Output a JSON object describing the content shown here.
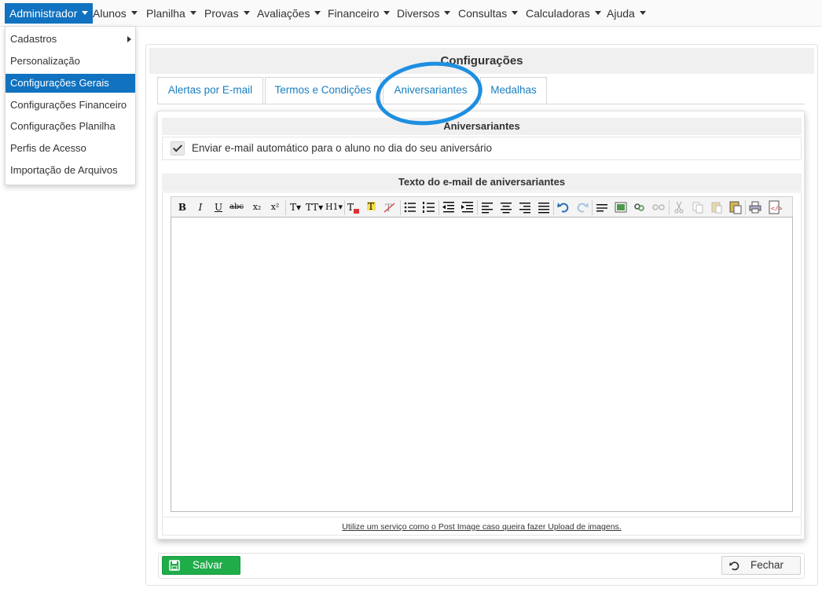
{
  "menu": {
    "items": [
      {
        "label": "Administrador"
      },
      {
        "label": "Alunos"
      },
      {
        "label": "Planilha"
      },
      {
        "label": "Provas"
      },
      {
        "label": "Avaliações"
      },
      {
        "label": "Financeiro"
      },
      {
        "label": "Diversos"
      },
      {
        "label": "Consultas"
      },
      {
        "label": "Calculadoras"
      },
      {
        "label": "Ajuda"
      }
    ]
  },
  "dropdown": {
    "items": [
      {
        "label": "Cadastros"
      },
      {
        "label": "Personalização"
      },
      {
        "label": "Configurações Gerais"
      },
      {
        "label": "Configurações Financeiro"
      },
      {
        "label": "Configurações Planilha"
      },
      {
        "label": "Perfis de Acesso"
      },
      {
        "label": "Importação de Arquivos"
      }
    ]
  },
  "panel": {
    "title": "Configurações",
    "tabs": [
      {
        "label": "Alertas por E-mail"
      },
      {
        "label": "Termos e Condições"
      },
      {
        "label": "Aniversariantes"
      },
      {
        "label": "Medalhas"
      }
    ]
  },
  "section": {
    "title": "Aniversariantes",
    "checkbox_label": "Enviar e-mail automático para o aluno no dia do seu aniversário",
    "checkbox_checked": true,
    "email_text_title": "Texto do e-mail de aniversariantes",
    "hint": "Utilize um serviço como o Post Image caso queira fazer Upload de imagens."
  },
  "toolbar": {
    "bold": "B",
    "italic": "I",
    "underline": "U",
    "strike": "abc",
    "subscript": "x₂",
    "superscript": "x²",
    "font": "T▾",
    "font_size": "TT▾",
    "heading": "H1▾"
  },
  "footer": {
    "save_label": "Salvar",
    "close_label": "Fechar"
  },
  "colors": {
    "accent": "#1072c0",
    "tab_text": "#1a7fbf",
    "save_green": "#1fad4a",
    "annotation_circle": "#1e8fe0"
  }
}
